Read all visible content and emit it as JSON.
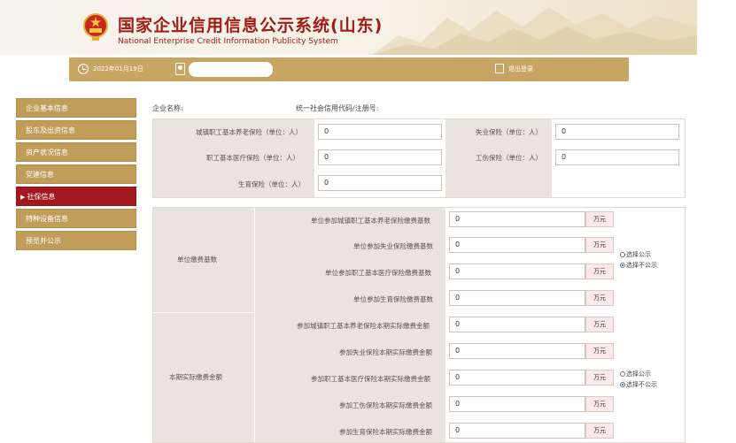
{
  "header": {
    "title_cn": "国家企业信用信息公示系统(山东)",
    "title_en": "National Enterprise Credit Information Publicity System"
  },
  "topbar": {
    "date": "2022年01月19日",
    "logout": "退出登录"
  },
  "sidebar": {
    "items": [
      {
        "label": "企业基本信息",
        "active": false
      },
      {
        "label": "股东及出资信息",
        "active": false
      },
      {
        "label": "资产状况信息",
        "active": false
      },
      {
        "label": "党建信息",
        "active": false
      },
      {
        "label": "社保信息",
        "active": true
      },
      {
        "label": "特种设备信息",
        "active": false
      },
      {
        "label": "预览并公示",
        "active": false
      }
    ]
  },
  "main": {
    "org_label": "企业名称:",
    "credit_label": "统一社会信用代码/注册号:",
    "headcount": {
      "pension_label": "城镇职工基本养老保险（单位：人）",
      "pension_value": "0",
      "unemployment_label": "失业保险（单位：人）",
      "unemployment_value": "0",
      "medical_label": "职工基本医疗保险（单位：人）",
      "medical_value": "0",
      "injury_label": "工伤保险（单位：人）",
      "injury_value": "0",
      "maternity_label": "生育保险（单位：人）",
      "maternity_value": "0"
    },
    "base": {
      "group_label": "单位缴费基数",
      "unit": "万元",
      "rows": [
        {
          "label": "单位参加城镇职工基本养老保险缴费基数",
          "value": "0"
        },
        {
          "label": "单位参加失业保险缴费基数",
          "value": "0"
        },
        {
          "label": "单位参加职工基本医疗保险缴费基数",
          "value": "0"
        },
        {
          "label": "单位参加生育保险缴费基数",
          "value": "0"
        }
      ],
      "public_option": "选择公示",
      "private_option": "选择不公示"
    },
    "actual": {
      "group_label": "本期实际缴费金额",
      "unit": "万元",
      "rows": [
        {
          "label": "参加城镇职工基本养老保险本期实际缴费金额",
          "value": "0"
        },
        {
          "label": "参加失业保险本期实际缴费金额",
          "value": "0"
        },
        {
          "label": "参加职工基本医疗保险本期实际缴费金额",
          "value": "0"
        },
        {
          "label": "参加工伤保险本期实际缴费金额",
          "value": "0"
        },
        {
          "label": "参加生育保险本期实际缴费金额",
          "value": "0"
        }
      ],
      "public_option": "选择公示",
      "private_option": "选择不公示"
    }
  },
  "colors": {
    "brand_red": "#a01c16",
    "gold": "#c9a563",
    "sidebar_active": "#a3181f"
  }
}
